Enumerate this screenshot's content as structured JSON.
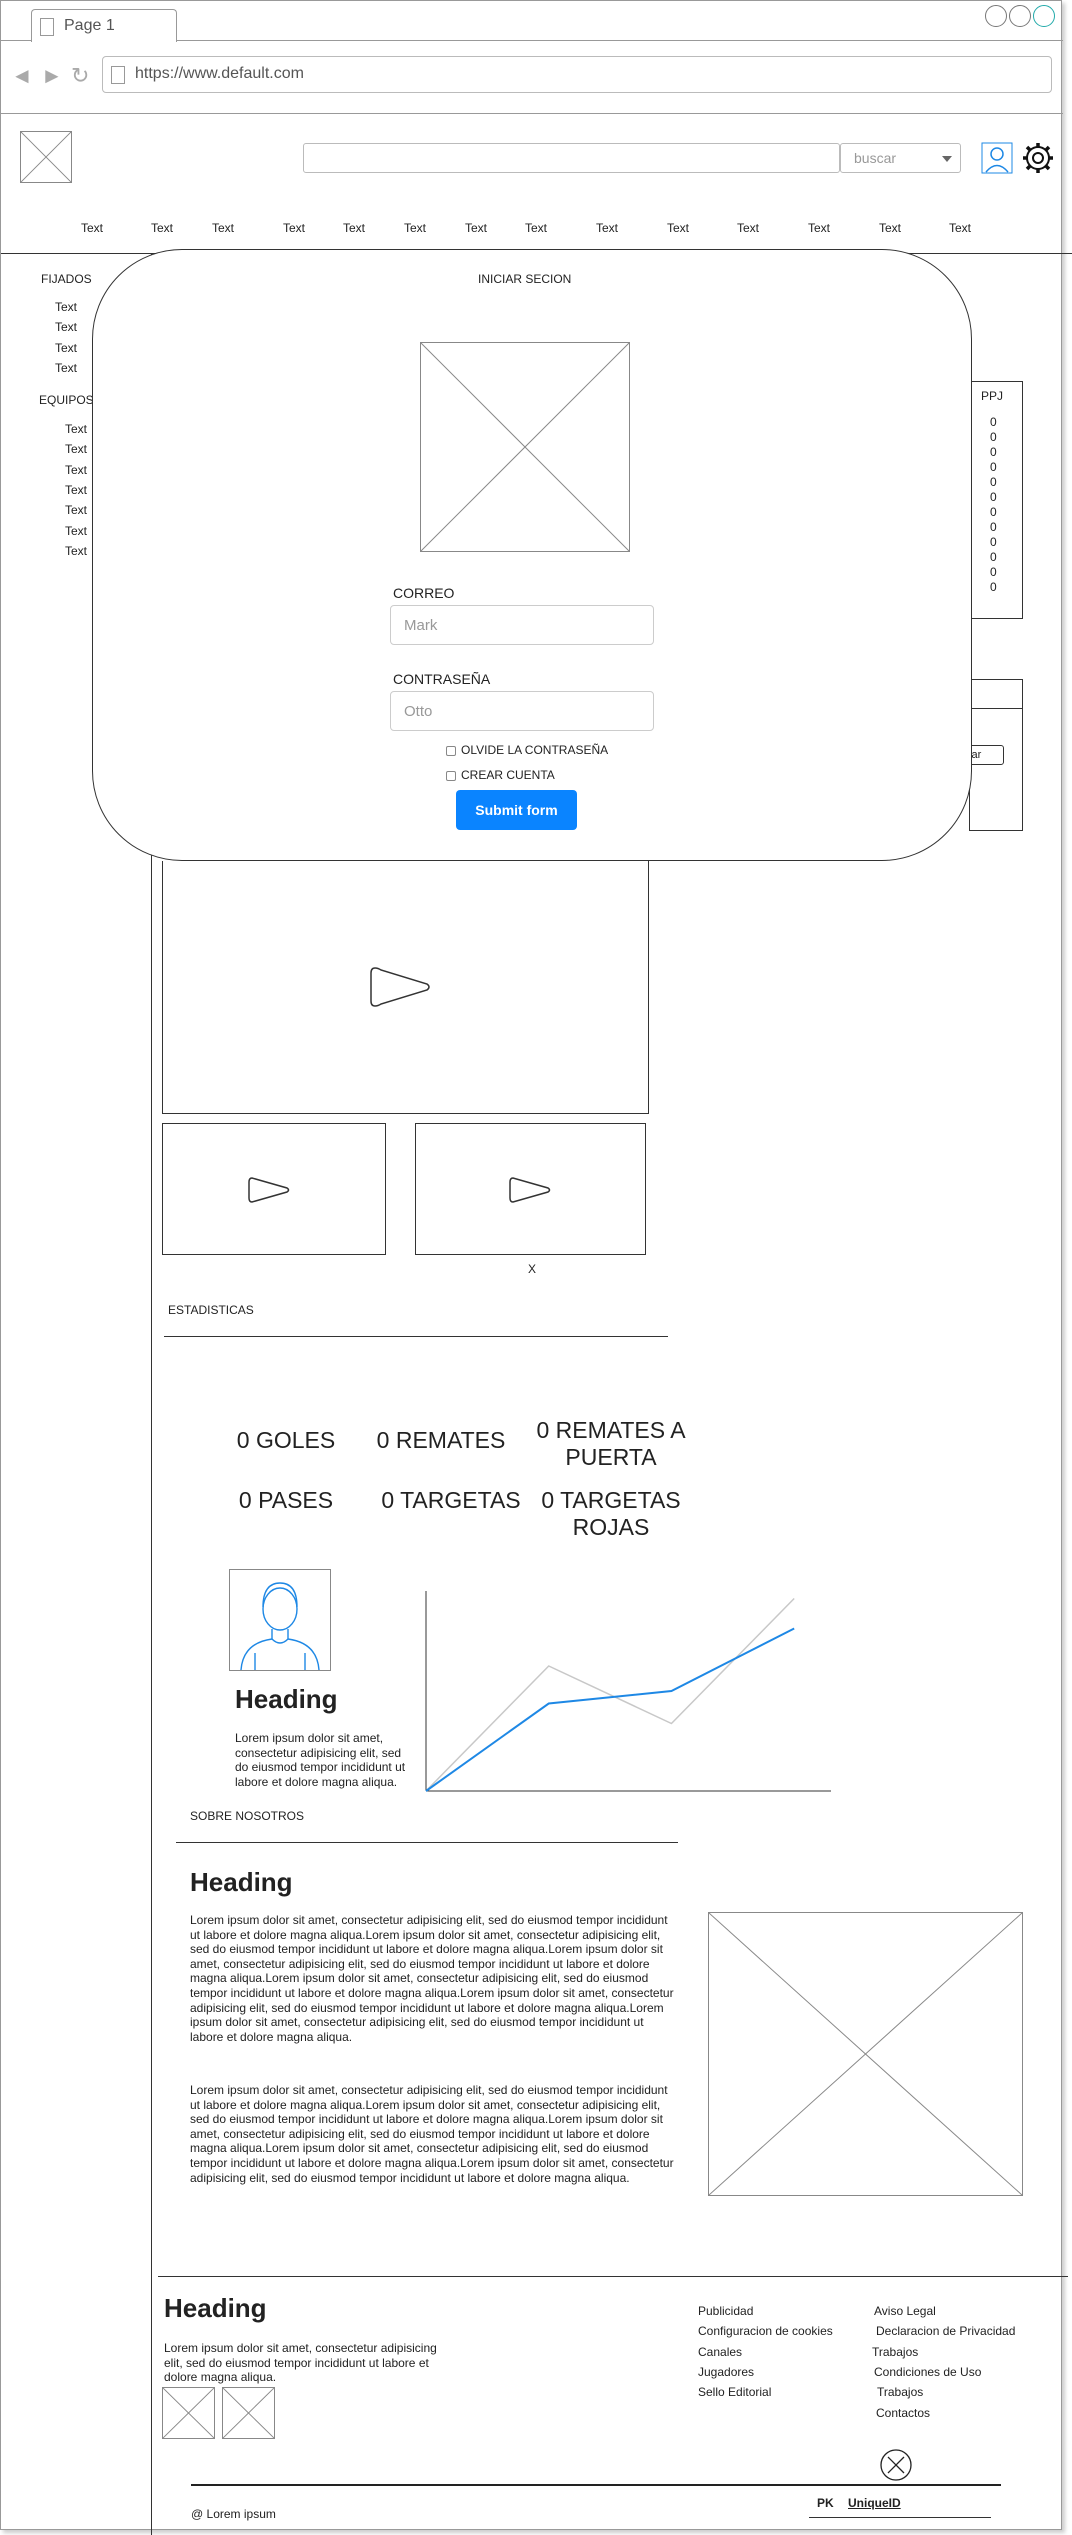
{
  "browser": {
    "tab_title": "Page 1",
    "url": "https://www.default.com"
  },
  "header": {
    "search_placeholder": "",
    "search_button_label": "buscar"
  },
  "nav": {
    "items": [
      "Text",
      "Text",
      "Text",
      "Text",
      "Text",
      "Text",
      "Text",
      "Text",
      "Text",
      "Text",
      "Text",
      "Text",
      "Text",
      "Text"
    ]
  },
  "sidebar": {
    "fijados_title": "FIJADOS",
    "fijados_items": [
      "Text",
      "Text",
      "Text",
      "Text"
    ],
    "equipos_title": "EQUIPOS",
    "equipos_items": [
      "Text",
      "Text",
      "Text",
      "Text",
      "Text",
      "Text",
      "Text"
    ]
  },
  "right_panel": {
    "header": "PPJ",
    "values": [
      "0",
      "0",
      "0",
      "0",
      "0",
      "0",
      "0",
      "0",
      "0",
      "0",
      "0",
      "0"
    ],
    "button_partial": "var"
  },
  "modal": {
    "title": "INICIAR SECION",
    "email_label": "CORREO",
    "email_value": "Mark",
    "password_label": "CONTRASEÑA",
    "password_value": "Otto",
    "forgot_label": "OLVIDE LA CONTRASEÑA",
    "create_label": "CREAR CUENTA",
    "submit_label": "Submit form"
  },
  "video": {
    "close_label": "X"
  },
  "stats": {
    "title": "ESTADISTICAS",
    "items": [
      "0 GOLES",
      "0 REMATES",
      "0 REMATES A PUERTA",
      "0 PASES",
      "0 TARGETAS",
      "0 TARGETAS ROJAS"
    ]
  },
  "profile": {
    "heading": "Heading",
    "text": "Lorem ipsum dolor sit amet, consectetur adipisicing elit, sed do eiusmod tempor incididunt ut labore et dolore magna aliqua."
  },
  "chart_data": {
    "type": "line",
    "x": [
      0,
      1,
      2,
      3
    ],
    "series": [
      {
        "values": [
          0,
          3.5,
          4.0,
          6.5
        ],
        "color": "#1e88e5"
      },
      {
        "values": [
          0,
          5.0,
          2.7,
          7.7
        ],
        "color": "#c8c8c8"
      }
    ],
    "xlim": [
      0,
      3.3
    ],
    "ylim": [
      0,
      8
    ]
  },
  "about": {
    "title": "SOBRE NOSOTROS",
    "heading": "Heading",
    "para1": "Lorem ipsum dolor sit amet, consectetur adipisicing elit, sed do eiusmod tempor incididunt ut labore et dolore magna aliqua.Lorem ipsum dolor sit amet, consectetur adipisicing elit, sed do eiusmod tempor incididunt ut labore et dolore magna aliqua.Lorem ipsum dolor sit amet, consectetur adipisicing elit, sed do eiusmod tempor incididunt ut labore et dolore magna aliqua.Lorem ipsum dolor sit amet, consectetur adipisicing elit, sed do eiusmod tempor incididunt ut labore et dolore magna aliqua.Lorem ipsum dolor sit amet, consectetur adipisicing elit, sed do eiusmod tempor incididunt ut labore et dolore magna aliqua.Lorem ipsum dolor sit amet, consectetur adipisicing elit, sed do eiusmod tempor incididunt ut labore et dolore magna aliqua.",
    "para2": "Lorem ipsum dolor sit amet, consectetur adipisicing elit, sed do eiusmod tempor incididunt ut labore et dolore magna aliqua.Lorem ipsum dolor sit amet, consectetur adipisicing elit, sed do eiusmod tempor incididunt ut labore et dolore magna aliqua.Lorem ipsum dolor sit amet, consectetur adipisicing elit, sed do eiusmod tempor incididunt ut labore et dolore magna aliqua.Lorem ipsum dolor sit amet, consectetur adipisicing elit, sed do eiusmod tempor incididunt ut labore et dolore magna aliqua.Lorem ipsum dolor sit amet, consectetur adipisicing elit, sed do eiusmod tempor incididunt ut labore et dolore magna aliqua."
  },
  "footer": {
    "heading": "Heading",
    "text": "Lorem ipsum dolor sit amet, consectetur adipisicing elit, sed do eiusmod tempor incididunt ut labore et dolore magna aliqua.",
    "links_col1": [
      "Publicidad",
      "Configuracion de cookies",
      "Canales",
      "Jugadores",
      "Sello Editorial"
    ],
    "links_col2": [
      "Aviso Legal",
      "Declaracion de Privacidad",
      "Trabajos",
      "Condiciones de Uso",
      "Trabajos",
      "Contactos"
    ],
    "copyright": "@ Lorem ipsum",
    "pk_label": "PK",
    "unique_label": "UniqueID"
  }
}
